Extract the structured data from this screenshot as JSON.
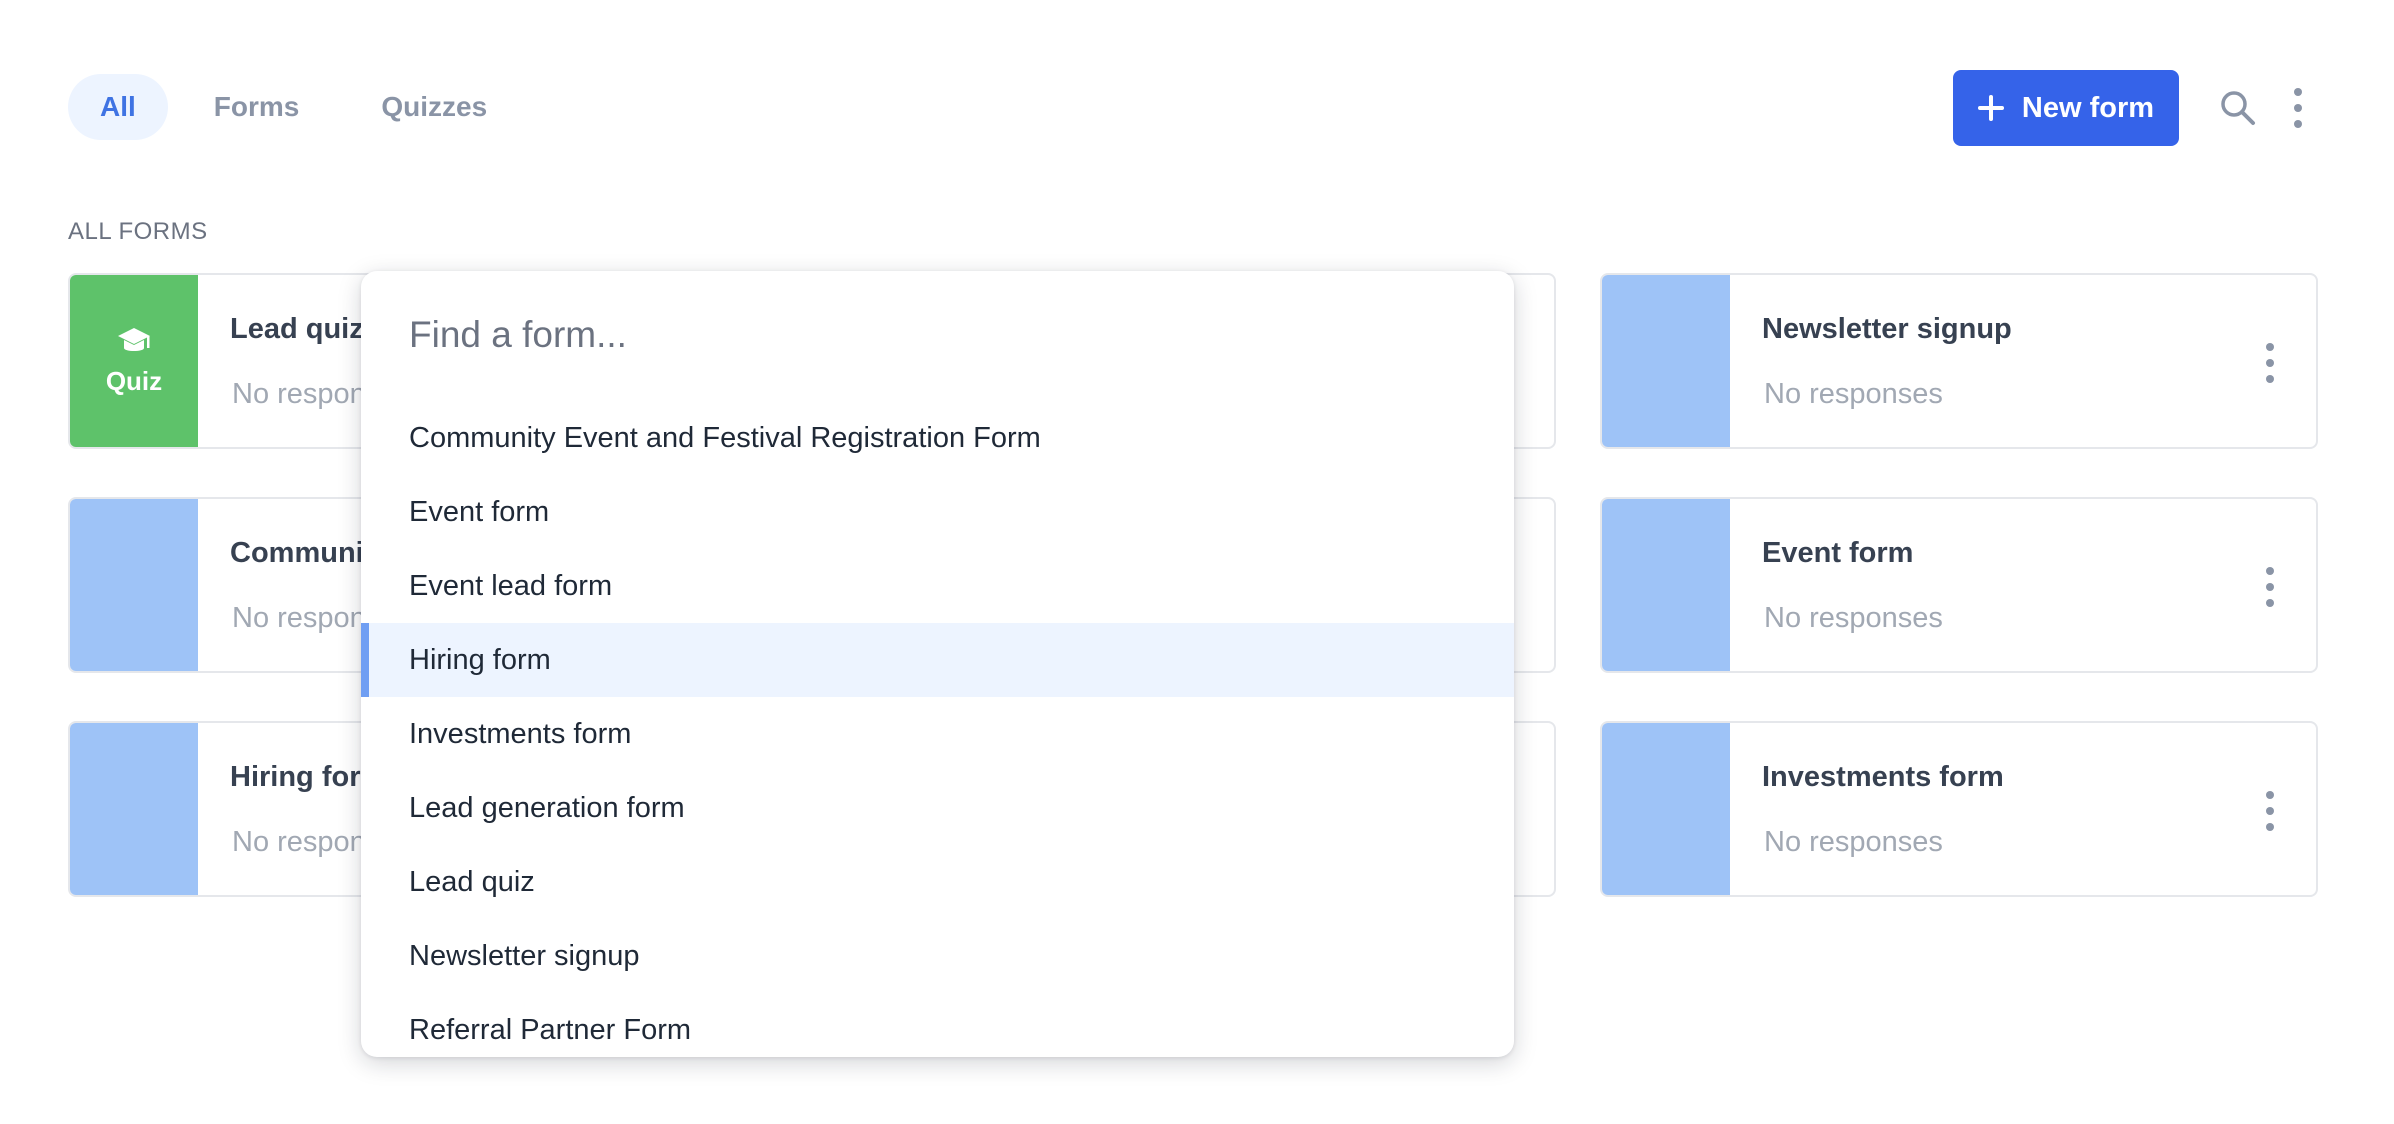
{
  "tabs": [
    {
      "label": "All",
      "active": true
    },
    {
      "label": "Forms",
      "active": false
    },
    {
      "label": "Quizzes",
      "active": false
    }
  ],
  "toolbar": {
    "new_form_label": "New form",
    "icons": [
      "plus-icon",
      "search-icon",
      "more-vertical-icon"
    ]
  },
  "section_title": "ALL FORMS",
  "cards": [
    {
      "title": "Lead quiz",
      "subtitle": "No responses",
      "thumb": "quiz",
      "thumb_label": "Quiz",
      "thumb_icon": "graduation-cap-icon"
    },
    {
      "title": "Newsletter signup",
      "subtitle": "No responses",
      "thumb": "form"
    },
    {
      "title": "Communit",
      "subtitle": "No respon",
      "thumb": "form"
    },
    {
      "title": "Event form",
      "subtitle": "No responses",
      "thumb": "form"
    },
    {
      "title": "Hiring forr",
      "subtitle": "No respon",
      "thumb": "form"
    },
    {
      "title": "Investments form",
      "subtitle": "No responses",
      "thumb": "form"
    }
  ],
  "lead_card": {
    "title": "Lead quiz",
    "subtitle": "No respon"
  },
  "dropdown": {
    "placeholder": "Find a form...",
    "options": [
      "Community Event and Festival Registration Form",
      "Event form",
      "Event lead form",
      "Hiring form",
      "Investments form",
      "Lead generation form",
      "Lead quiz",
      "Newsletter signup",
      "Referral Partner Form"
    ],
    "highlighted": "Hiring form"
  },
  "colors": {
    "primary": "#3563e9",
    "quiz_green": "#5ec26a",
    "form_thumb_blue": "#9ec3f7",
    "tab_active_bg": "#edf4ff",
    "highlight_bar": "#6f9ef3"
  }
}
